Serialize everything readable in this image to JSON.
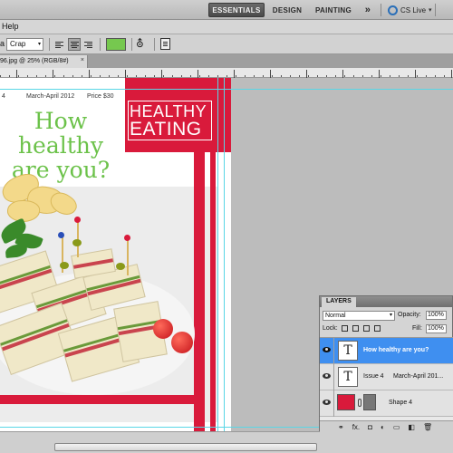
{
  "app_bar": {
    "workspaces": [
      "ESSENTIALS",
      "DESIGN",
      "PAINTING"
    ],
    "more_glyph": "»",
    "cs_live": "CS Live",
    "caret": "▾"
  },
  "menubar": {
    "help": "Help"
  },
  "options_bar": {
    "font_label_partial": "a",
    "font_style": "Crap",
    "dropdown_glyph": "▾",
    "text_color": "#76c84f",
    "warp_glyph": "⛢"
  },
  "document": {
    "tab_title": "96.jpg @ 25% (RGB/8#)",
    "tab_close": "×",
    "cover_issue": "4",
    "cover_date": "March-April 2012",
    "cover_price": "Price  $30",
    "cover_headline_1": "How healthy",
    "cover_headline_2": "are you?",
    "banner_1": "HEALTHY",
    "banner_2": "EATING",
    "accent_red": "#d91a3b",
    "headline_green": "#6cc24a"
  },
  "layers_panel": {
    "tab_label": "LAYERS",
    "blend_mode": "Normal",
    "opacity_label": "Opacity:",
    "opacity_value": "100%",
    "lock_label": "Lock:",
    "fill_label": "Fill:",
    "fill_value": "100%",
    "layers": [
      {
        "name": "How healthy are you?",
        "thumb": "T",
        "selected": true
      },
      {
        "name_a": "Issue 4",
        "name_b": "March-April 201...",
        "thumb": "T",
        "selected": false
      },
      {
        "name": "Shape 4",
        "thumb": "shape",
        "selected": false
      }
    ],
    "footer_glyphs": [
      "⚭",
      "fx.",
      "◘",
      "◐",
      "▭",
      "◧",
      "🗑"
    ]
  }
}
